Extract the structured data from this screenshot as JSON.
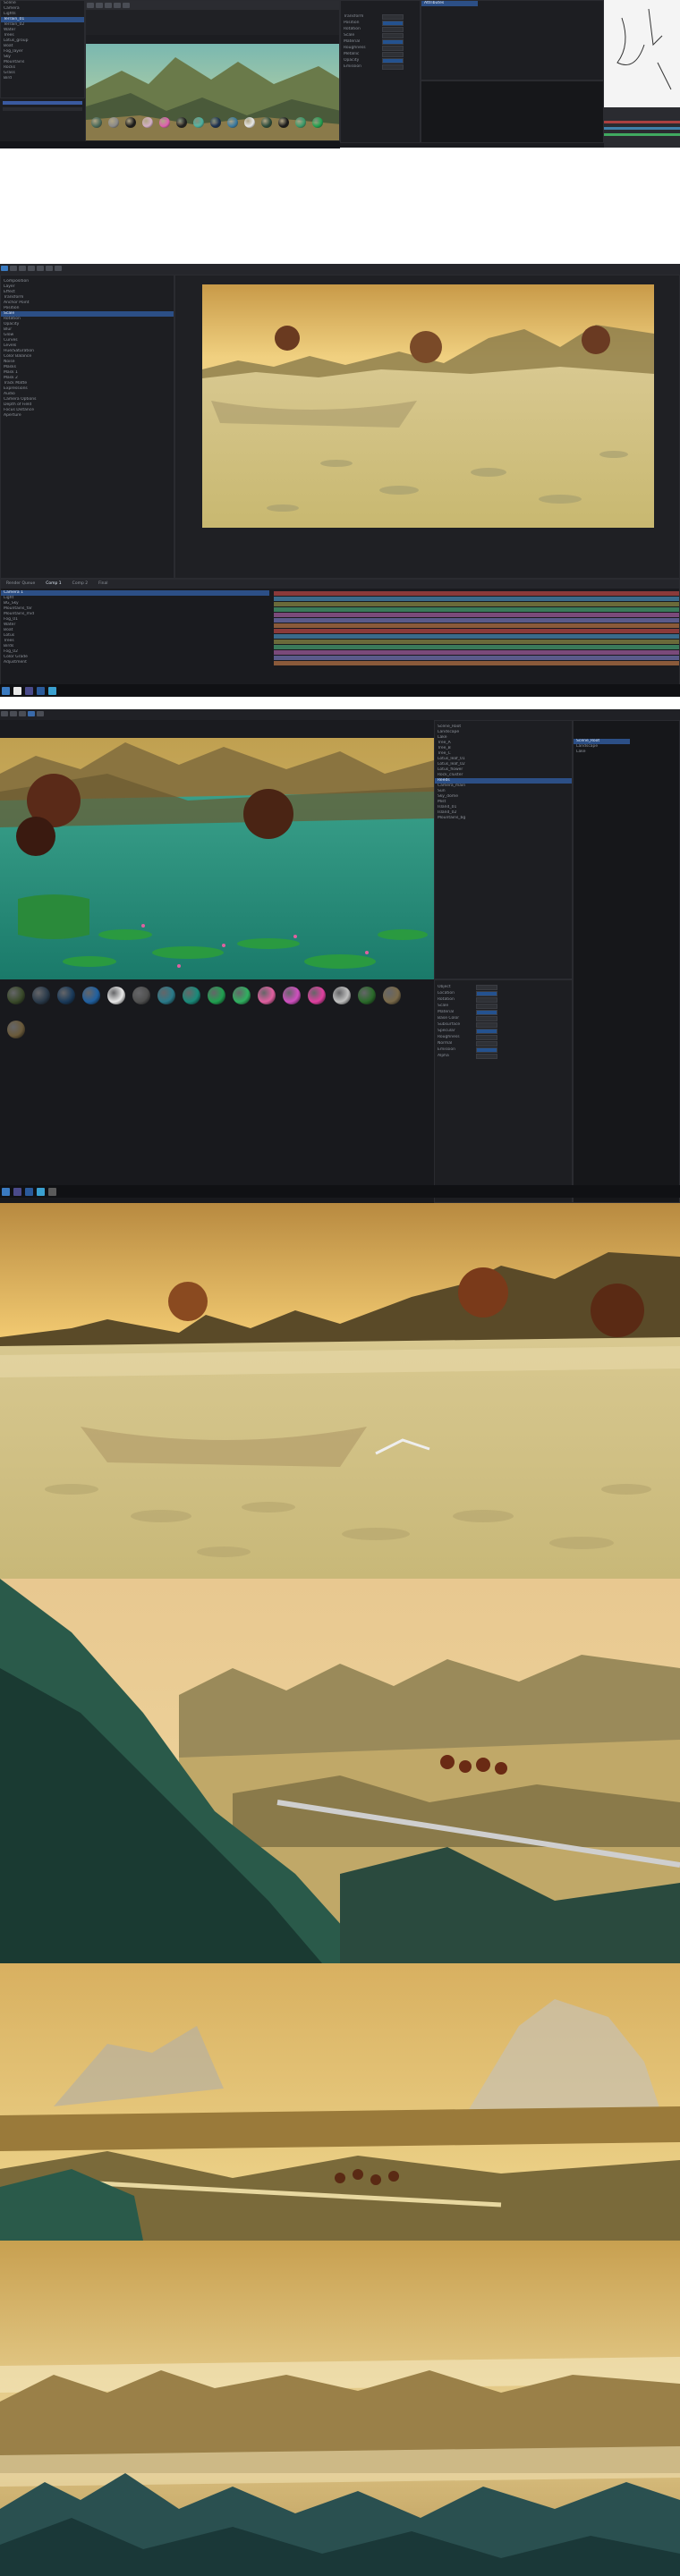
{
  "screenshot1": {
    "menu": [
      "Tools",
      "Layout",
      "Viewport",
      "Render"
    ],
    "tabs": [
      "Scene",
      "Objects"
    ],
    "tree_items": [
      "Scene",
      "Camera",
      "Lights",
      "Terrain_01",
      "Terrain_02",
      "Water",
      "Trees",
      "Lotus_group",
      "Boat",
      "Fog_layer",
      "Sky",
      "Mountains",
      "Rocks",
      "Grass",
      "Bird"
    ],
    "props": [
      "Transform",
      "Position",
      "Rotation",
      "Scale",
      "Material",
      "Roughness",
      "Metallic",
      "Opacity",
      "Emission"
    ],
    "material_colors": [
      "#4a6a5a",
      "#8a8a8a",
      "#1a1a1a",
      "#d4b0c8",
      "#e060b0",
      "#202020",
      "#4ab0a0",
      "#1a3050",
      "#3a7aa0",
      "#e8e8e8",
      "#2a4a3a",
      "#1a1a1a",
      "#3a9a6a",
      "#20a050"
    ]
  },
  "screenshot2": {
    "left_panel_items": [
      "Composition",
      "Layer",
      "Effect",
      "Transform",
      "Anchor Point",
      "Position",
      "Scale",
      "Rotation",
      "Opacity",
      "Blur",
      "Glow",
      "Curves",
      "Levels",
      "Hue/Saturation",
      "Color Balance",
      "Noise",
      "Masks",
      "Mask 1",
      "Mask 2",
      "Track Matte",
      "Expressions",
      "Audio",
      "Camera Options",
      "Depth of Field",
      "Focus Distance",
      "Aperture"
    ],
    "timeline_layers": [
      "Camera 1",
      "Light",
      "BG_Sky",
      "Mountains_far",
      "Mountains_mid",
      "Fog_01",
      "Water",
      "Boat",
      "Lotus",
      "Trees",
      "Birds",
      "Fog_02",
      "Color Grade",
      "Adjustment"
    ],
    "tabs": [
      "Render Queue",
      "Comp 1",
      "Comp 2",
      "Final"
    ]
  },
  "screenshot3": {
    "outliner": [
      "Scene_Root",
      "Landscape",
      "Lake",
      "Tree_A",
      "Tree_B",
      "Tree_C",
      "Lotus_leaf_01",
      "Lotus_leaf_02",
      "Lotus_flower",
      "Rock_cluster",
      "Reeds",
      "Camera_main",
      "Sun",
      "Sky_dome",
      "Mist",
      "Island_01",
      "Island_02",
      "Mountains_bg"
    ],
    "props": [
      "Object",
      "Location",
      "Rotation",
      "Scale",
      "Material",
      "Base Color",
      "Subsurface",
      "Specular",
      "Roughness",
      "Normal",
      "Emission",
      "Alpha"
    ],
    "material_colors": [
      "#3a4a2a",
      "#2a3a4a",
      "#1a3a5a",
      "#2060a0",
      "#e8e8e8",
      "#505050",
      "#2a7a8a",
      "#1a8a7a",
      "#20a050",
      "#30b060",
      "#e060a0",
      "#d050c0",
      "#e040a0",
      "#c0c0c0",
      "#2a6a2a",
      "#7a6a4a",
      "#6a5a3a"
    ]
  },
  "renders": {
    "count": 4
  }
}
